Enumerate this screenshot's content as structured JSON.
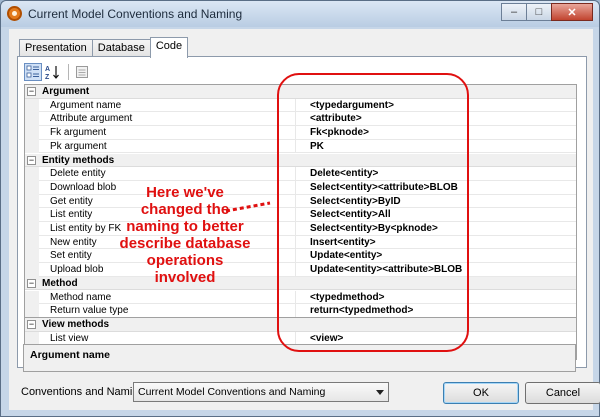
{
  "window": {
    "title": "Current Model Conventions and Naming",
    "buttons": {
      "minimize": "‒",
      "maximize": "□",
      "close": "✕"
    }
  },
  "tabs": [
    {
      "label": "Presentation",
      "active": false
    },
    {
      "label": "Database",
      "active": false
    },
    {
      "label": "Code",
      "active": true
    }
  ],
  "toolbar": {
    "categorized_icon": "categorized-view-icon",
    "alphabetical_icon": "alphabetical-sort-icon",
    "pages_icon": "property-pages-icon"
  },
  "grid": {
    "rows": [
      {
        "type": "category",
        "label": "Argument"
      },
      {
        "type": "property",
        "label": "Argument name",
        "value": "<typedargument>"
      },
      {
        "type": "property",
        "label": "Attribute argument",
        "value": "<attribute>"
      },
      {
        "type": "property",
        "label": "Fk argument",
        "value": "Fk<pknode>"
      },
      {
        "type": "property",
        "label": "Pk argument",
        "value": "PK"
      },
      {
        "type": "category",
        "label": "Entity methods"
      },
      {
        "type": "property",
        "label": "Delete entity",
        "value": "Delete<entity>"
      },
      {
        "type": "property",
        "label": "Download blob",
        "value": "Select<entity><attribute>BLOB"
      },
      {
        "type": "property",
        "label": "Get entity",
        "value": "Select<entity>ByID"
      },
      {
        "type": "property",
        "label": "List entity",
        "value": "Select<entity>All"
      },
      {
        "type": "property",
        "label": "List entity by FK",
        "value": "Select<entity>By<pknode>"
      },
      {
        "type": "property",
        "label": "New entity",
        "value": "Insert<entity>"
      },
      {
        "type": "property",
        "label": "Set entity",
        "value": "Update<entity>"
      },
      {
        "type": "property",
        "label": "Upload blob",
        "value": "Update<entity><attribute>BLOB"
      },
      {
        "type": "category",
        "label": "Method"
      },
      {
        "type": "property",
        "label": "Method name",
        "value": "<typedmethod>"
      },
      {
        "type": "property",
        "label": "Return value type",
        "value": "return<typedmethod>"
      },
      {
        "type": "category",
        "label": "View methods"
      },
      {
        "type": "property",
        "label": "List view",
        "value": "<view>"
      }
    ]
  },
  "description": {
    "title": "Argument name"
  },
  "footer": {
    "conventions_label": "Conventions and Naming:",
    "conventions_value": "Current Model Conventions and Naming",
    "ok_label": "OK",
    "cancel_label": "Cancel"
  },
  "annotation": {
    "lines": [
      "Here we've",
      "changed the",
      "naming to better",
      "describe database",
      "operations",
      "involved"
    ],
    "color": "#e01010"
  }
}
